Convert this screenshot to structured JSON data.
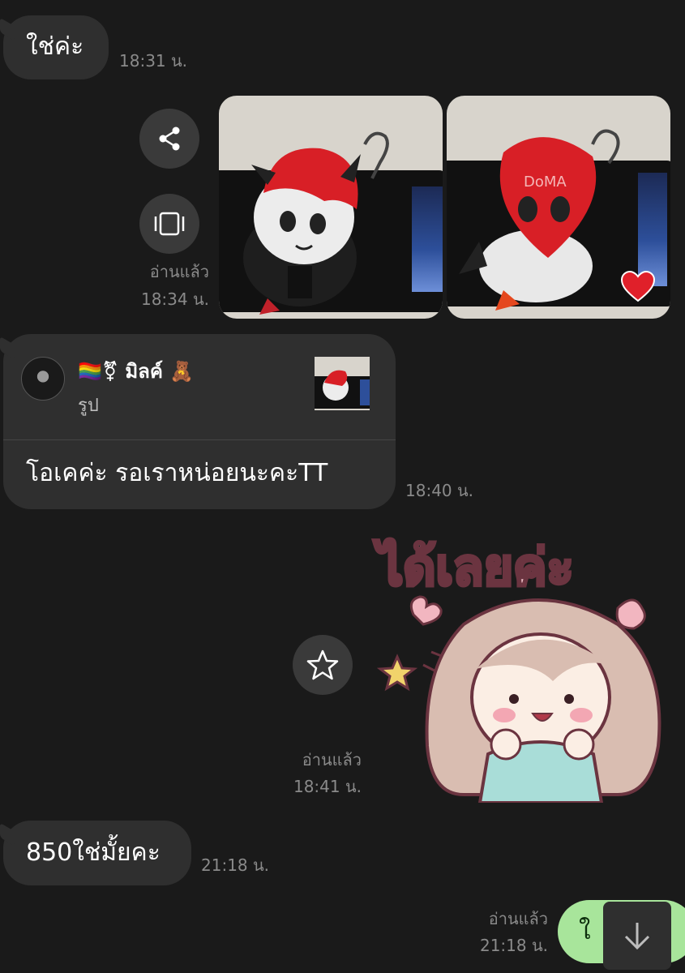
{
  "messages": {
    "m1": {
      "text": "ใช่ค่ะ",
      "time": "18:31 น."
    },
    "photos": {
      "read": "อ่านแล้ว",
      "time": "18:34 น."
    },
    "reply": {
      "sender": "🏳️‍🌈⚧ มิลค์ 🧸",
      "quoted_type": "รูป",
      "text": "โอเคค่ะ รอเราหน่อยนะคะTT",
      "time": "18:40 น."
    },
    "sticker": {
      "caption": "ได้เลยค่ะ",
      "read": "อ่านแล้ว",
      "time": "18:41 น."
    },
    "m4": {
      "text": "850ใช่มั้ยคะ",
      "time": "21:18 น."
    },
    "m5": {
      "text": "ใ",
      "read": "อ่านแล้ว",
      "time": "21:18 น."
    }
  },
  "icons": {
    "share": "share-icon",
    "carousel": "carousel-icon",
    "star": "star-icon",
    "scroll_down": "arrow-down-icon",
    "heart": "heart-reaction-icon"
  },
  "colors": {
    "background": "#1a1a1a",
    "incoming_bubble": "#2f2f2f",
    "outgoing_bubble": "#a8e59b",
    "meta_text": "#8a8a8a",
    "heart": "#e0202a"
  }
}
